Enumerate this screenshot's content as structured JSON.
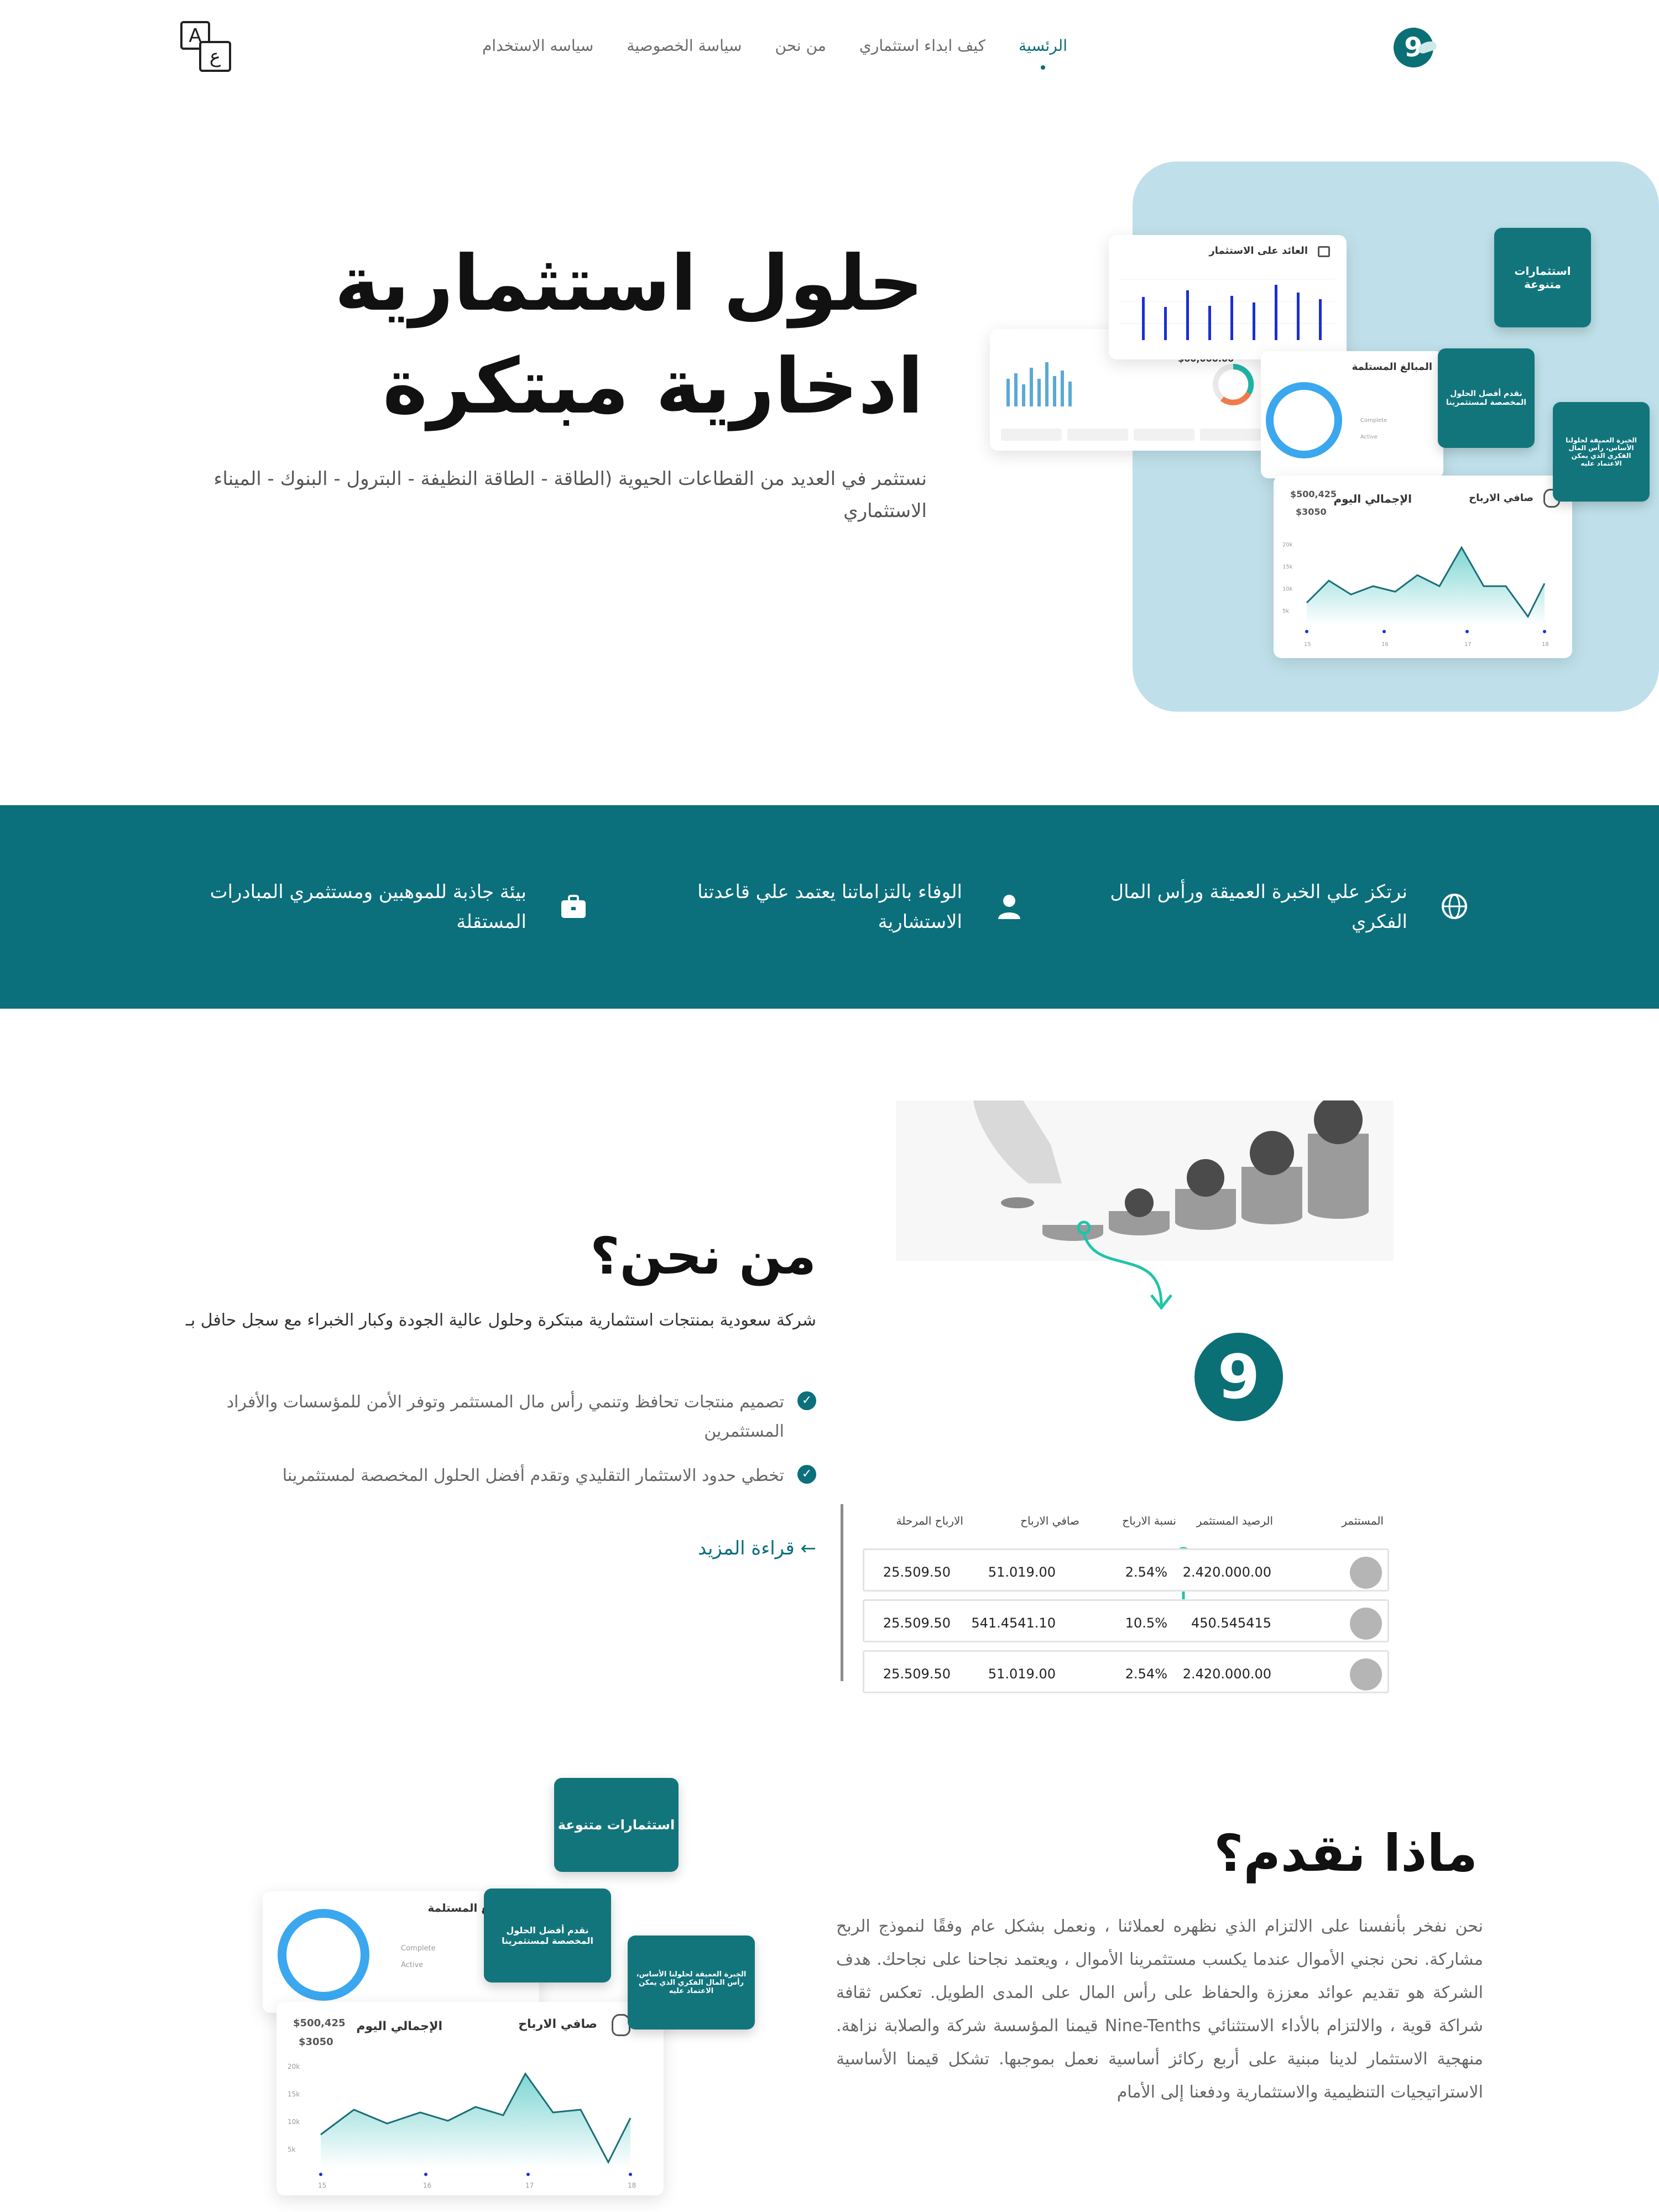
{
  "nav": {
    "items": [
      {
        "label": "الرئسية",
        "active": true
      },
      {
        "label": "كيف ابداء استثماري",
        "active": false
      },
      {
        "label": "من نحن",
        "active": false
      },
      {
        "label": "سياسة الخصوصية",
        "active": false
      },
      {
        "label": "سياسه الاستخدام",
        "active": false
      }
    ],
    "logo_glyph": "9",
    "lang_a": "A",
    "lang_b": "ع"
  },
  "hero": {
    "title_line1": "حلول استثمارية",
    "title_line2": "ادخارية مبتكرة",
    "description": "نستثمر في العديد من القطاعات الحيوية (الطاقة - الطاقة النظيفة - البترول - البنوك - الميناء الاستثماري",
    "dashboard": {
      "roi_title": "العائد على الاستثمار",
      "amount": "$60,000.00",
      "due_title": "المبالغ المستلمة",
      "legend_complete": "Complete",
      "legend_active": "Active",
      "profit_title": "صافي الارباح",
      "total_title": "الإجمالي اليوم",
      "total_value": "$500,425",
      "today_value": "$3050",
      "y_ticks": [
        "20k",
        "15k",
        "10k",
        "5k"
      ],
      "x_ticks": [
        "15",
        "16",
        "17",
        "18"
      ],
      "card_diverse": "استثمارات متنوعة",
      "card_best": "نقدم أفضل الحلول المخصصة لمستثمرينا",
      "card_expertise": "الخبرة العميقة لحلولنا الأساس، رأس المال الفكري الذي يمكن الاعتماد عليه"
    }
  },
  "features": [
    {
      "icon": "globe-icon",
      "text": "نرتكز علي الخبرة العميقة ورأس المال الفكري"
    },
    {
      "icon": "user-icon",
      "text": "الوفاء بالتزاماتنا يعتمد علي قاعدتنا الاستشارية"
    },
    {
      "icon": "briefcase-icon",
      "text": "بيئة جاذبة للموهبين ومستثمري المبادرات المستقلة"
    }
  ],
  "about": {
    "title": "من نحن؟",
    "description": "شركة سعودية بمنتجات استثمارية مبتكرة وحلول عالية الجودة وكبار الخبراء مع سجل حافل بـ",
    "bullets": [
      "تصميم منتجات تحافظ وتنمي رأس مال المستثمر وتوفر الأمن للمؤسسات والأفراد المستثمرين",
      "تخطي حدود الاستثمار التقليدي وتقدم أفضل الحلول المخصصة لمستثمرينا"
    ],
    "read_more": "قراءة المزيد ←",
    "table": {
      "headers": [
        "المستثمر",
        "الرصيد المستثمر",
        "نسبة الارباح",
        "صافي الارباح",
        "الارباح المرحلة"
      ],
      "rows": [
        [
          "",
          "2.420.000.00",
          "2.54%",
          "51.019.00",
          "25.509.50"
        ],
        [
          "",
          "450.545415",
          "10.5%",
          "541.4541.10",
          "25.509.50"
        ],
        [
          "",
          "2.420.000.00",
          "2.54%",
          "51.019.00",
          "25.509.50"
        ]
      ]
    }
  },
  "offer": {
    "title": "ماذا نقدم؟",
    "description": "نحن نفخر بأنفسنا على الالتزام الذي نظهره لعملائنا ، ونعمل بشكل عام وفقًا لنموذج الربح مشاركة. نحن نجني الأموال عندما يكسب مستثمرينا الأموال ، ويعتمد نجاحنا على نجاحك. هدف الشركة هو تقديم عوائد معززة والحفاظ على رأس المال على المدى الطويل. تعكس ثقافة شراكة قوية ، والالتزام بالأداء الاستثنائي Nine-Tenths قيمنا المؤسسة شركة والصلابة نزاهة. منهجية الاستثمار لدينا مبنية على أربع ركائز أساسية نعمل بموجبها. تشكل قيمنا الأساسية الاستراتيجيات التنظيمية والاستثمارية ودفعنا إلى الأمام"
  },
  "colors": {
    "primary": "#0b6f7c",
    "card_teal": "#12757c",
    "hero_bg": "#bfe0ea"
  }
}
